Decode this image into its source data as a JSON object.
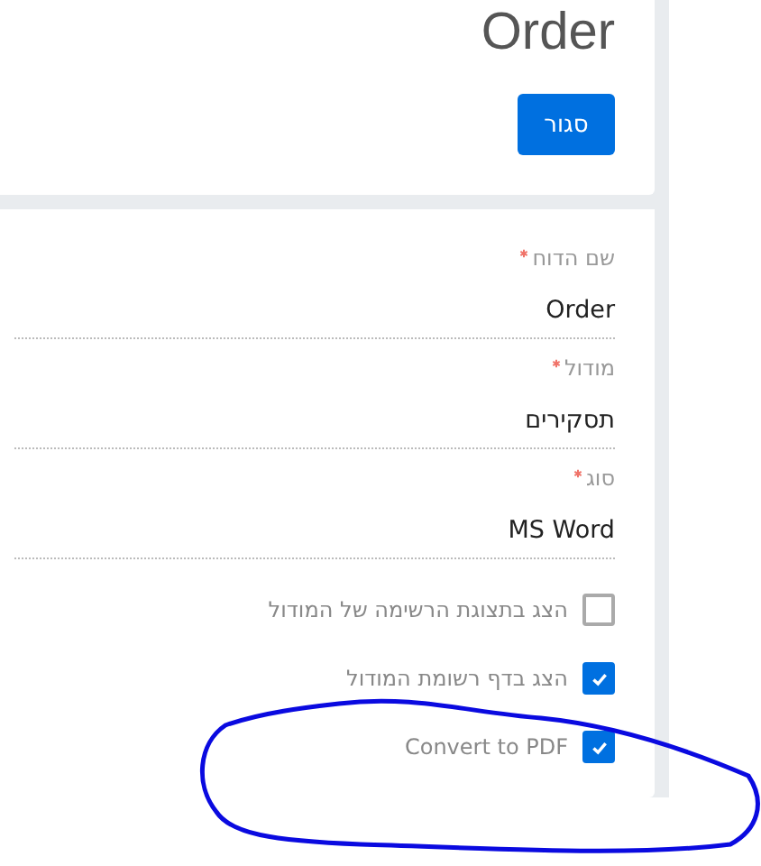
{
  "header": {
    "title": "Order",
    "close_button": "סגור"
  },
  "fields": [
    {
      "label": "שם הדוח",
      "required": true,
      "value": "Order"
    },
    {
      "label": "מודול",
      "required": true,
      "value": "תסקירים"
    },
    {
      "label": "סוג",
      "required": true,
      "value": "MS Word"
    }
  ],
  "checkboxes": [
    {
      "label": "הצג בתצוגת הרשימה של המודול",
      "checked": false
    },
    {
      "label": "הצג בדף רשומת המודול",
      "checked": true
    },
    {
      "label": "Convert to PDF",
      "checked": true
    }
  ]
}
